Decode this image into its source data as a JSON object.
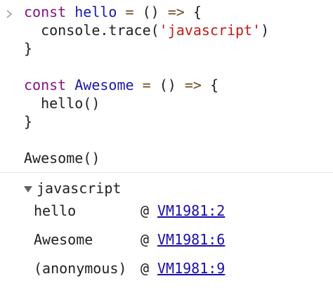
{
  "input": {
    "prompt_icon": "chevron-right-icon",
    "line1": {
      "kw": "const",
      "name": "hello",
      "eq": "=",
      "parens": "()",
      "arrow": "=>",
      "brace": "{"
    },
    "line2": {
      "call": "console.trace(",
      "arg": "'javascript'",
      "close": ")"
    },
    "line3": "}",
    "line5": {
      "kw": "const",
      "name": "Awesome",
      "eq": "=",
      "parens": "()",
      "arrow": "=>",
      "brace": "{"
    },
    "line6": "hello()",
    "line7": "}",
    "line9": "Awesome()"
  },
  "trace": {
    "title": "javascript",
    "expand_icon": "triangle-down-icon",
    "frames": [
      {
        "fn": "hello",
        "at": "@",
        "link": "VM1981:2"
      },
      {
        "fn": "Awesome",
        "at": "@",
        "link": "VM1981:6"
      },
      {
        "fn": "(anonymous)",
        "at": "@",
        "link": "VM1981:9"
      }
    ]
  },
  "colors": {
    "keyword": "#881280",
    "identifier": "#1a1aa6",
    "operator": "#6d4a1f",
    "string": "#c41a16",
    "link": "#1a0dab"
  }
}
